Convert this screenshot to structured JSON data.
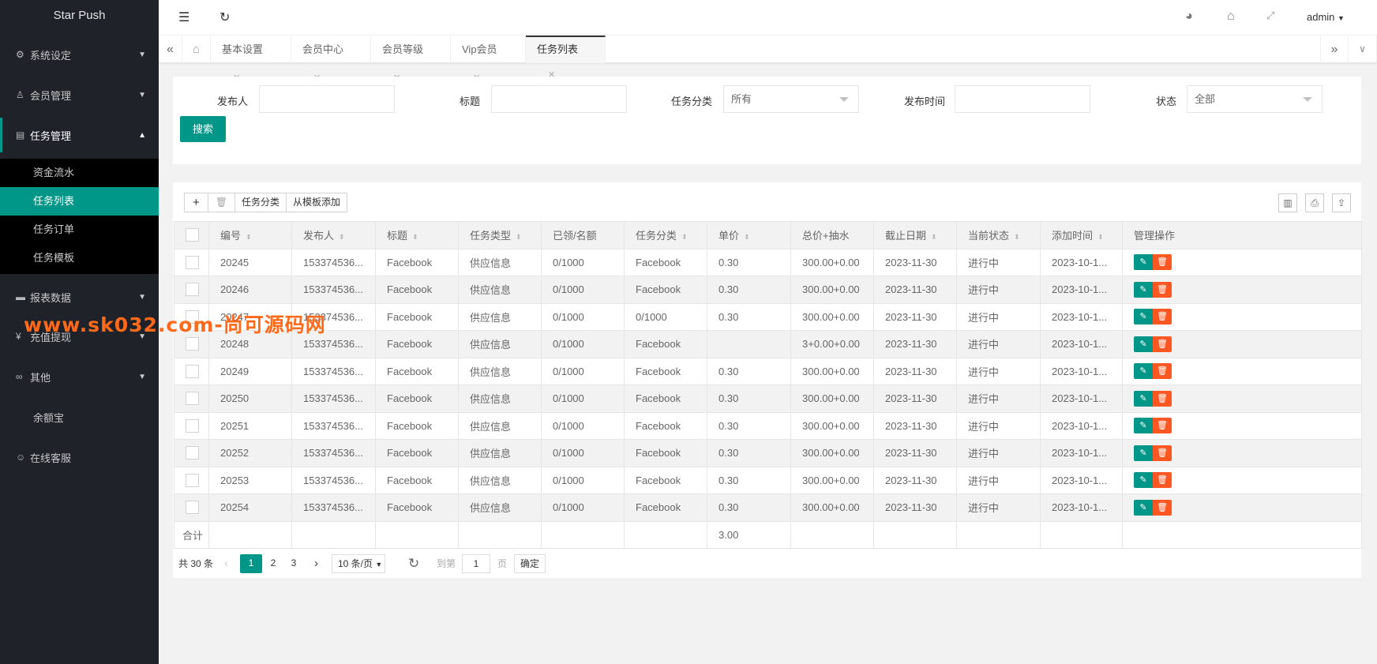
{
  "app": {
    "title": "Star Push"
  },
  "sidebar": {
    "items": [
      {
        "label": "系统设定",
        "icon": "gear-icon"
      },
      {
        "label": "会员管理",
        "icon": "user-icon"
      },
      {
        "label": "任务管理",
        "icon": "document-icon"
      },
      {
        "label": "报表数据",
        "icon": "chat-icon"
      },
      {
        "label": "充值提现",
        "icon": "yen-icon"
      },
      {
        "label": "其他",
        "icon": "link-icon"
      },
      {
        "label": "余额宝",
        "icon": ""
      },
      {
        "label": "在线客服",
        "icon": "service-icon"
      }
    ],
    "sub": [
      "资金流水",
      "任务列表",
      "任务订单",
      "任务模板"
    ]
  },
  "header": {
    "user": "admin"
  },
  "tabs": [
    {
      "label": "基本设置"
    },
    {
      "label": "会员中心"
    },
    {
      "label": "会员等级"
    },
    {
      "label": "Vip会员"
    },
    {
      "label": "任务列表",
      "active": true
    }
  ],
  "search": {
    "publisher": "发布人",
    "title": "标题",
    "category": "任务分类",
    "category_value": "所有",
    "time": "发布时间",
    "status": "状态",
    "status_value": "全部",
    "button": "搜索"
  },
  "toolbar": {
    "add": "+",
    "delete": "🗑",
    "category": "任务分类",
    "from_template": "从模板添加"
  },
  "table": {
    "columns": [
      "编号",
      "发布人",
      "标题",
      "任务类型",
      "已领/名额",
      "任务分类",
      "单价",
      "总价+抽水",
      "截止日期",
      "当前状态",
      "添加时间",
      "管理操作"
    ],
    "rows": [
      [
        "20245",
        "153374536...",
        "Facebook",
        "供应信息",
        "0/1000",
        "Facebook",
        "0.30",
        "300.00+0.00",
        "2023-11-30",
        "进行中",
        "2023-10-1..."
      ],
      [
        "20246",
        "153374536...",
        "Facebook",
        "供应信息",
        "0/1000",
        "Facebook",
        "0.30",
        "300.00+0.00",
        "2023-11-30",
        "进行中",
        "2023-10-1..."
      ],
      [
        "20247",
        "153374536...",
        "Facebook",
        "供应信息",
        "0/1000",
        "0/1000",
        "0.30",
        "300.00+0.00",
        "2023-11-30",
        "进行中",
        "2023-10-1..."
      ],
      [
        "20248",
        "153374536...",
        "Facebook",
        "供应信息",
        "0/1000",
        "Facebook",
        "",
        "3+0.00+0.00",
        "2023-11-30",
        "进行中",
        "2023-10-1..."
      ],
      [
        "20249",
        "153374536...",
        "Facebook",
        "供应信息",
        "0/1000",
        "Facebook",
        "0.30",
        "300.00+0.00",
        "2023-11-30",
        "进行中",
        "2023-10-1..."
      ],
      [
        "20250",
        "153374536...",
        "Facebook",
        "供应信息",
        "0/1000",
        "Facebook",
        "0.30",
        "300.00+0.00",
        "2023-11-30",
        "进行中",
        "2023-10-1..."
      ],
      [
        "20251",
        "153374536...",
        "Facebook",
        "供应信息",
        "0/1000",
        "Facebook",
        "0.30",
        "300.00+0.00",
        "2023-11-30",
        "进行中",
        "2023-10-1..."
      ],
      [
        "20252",
        "153374536...",
        "Facebook",
        "供应信息",
        "0/1000",
        "Facebook",
        "0.30",
        "300.00+0.00",
        "2023-11-30",
        "进行中",
        "2023-10-1..."
      ],
      [
        "20253",
        "153374536...",
        "Facebook",
        "供应信息",
        "0/1000",
        "Facebook",
        "0.30",
        "300.00+0.00",
        "2023-11-30",
        "进行中",
        "2023-10-1..."
      ],
      [
        "20254",
        "153374536...",
        "Facebook",
        "供应信息",
        "0/1000",
        "Facebook",
        "0.30",
        "300.00+0.00",
        "2023-11-30",
        "进行中",
        "2023-10-1..."
      ]
    ],
    "total_label": "合计",
    "total_price": "3.00"
  },
  "pagination": {
    "total": "共 30 条",
    "pages": [
      "1",
      "2",
      "3"
    ],
    "page_size": "10 条/页",
    "goto": "到第",
    "goto_value": "1",
    "page_unit": "页",
    "confirm": "确定"
  },
  "watermark": "www.sk032.com-尚可源码网",
  "colors": {
    "accent": "#009688",
    "danger": "#ff5722",
    "sidebar": "#20222a"
  }
}
